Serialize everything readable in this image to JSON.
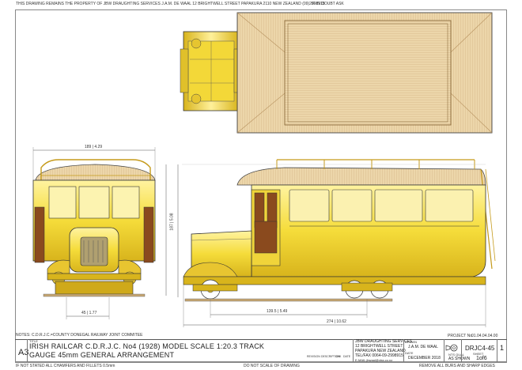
{
  "header": {
    "ownership_note": "THIS DRAWING REMAINS THE PROPERTY OF JBW DRAUGHTING SERVICES J.A.M. DE WAAL 12 BRIGHTWELL STREET PAPAKURA 2110 NEW ZEALAND (09)2998915",
    "doubt_note": "IF IN DOUBT ASK"
  },
  "dimensions": {
    "front_width": "189 | 4.29",
    "front_height": "187 | 5.08",
    "front_gauge": "45 | 1.77",
    "side_wheelbase": "139.5 | 5.49",
    "side_length": "274 | 10.62"
  },
  "title_block": {
    "notes": "NOTES: C.D.R.J.C.=COUNTY DONEGAL RAILWAY JOINT COMMITEE",
    "sheet_size": "A3",
    "title_label": "TITLE",
    "title_line1": "IRISH RAILCAR C.D.R.J.C. No4 (1928) MODEL SCALE 1:20.3 TRACK",
    "title_line2": "GAUGE 45mm  GENERAL ARRANGEMENT",
    "company_line1": "JBW DRAUGHTING SERVICES",
    "company_line2": "12 BRIGHTWELL STREET",
    "company_line3": "PAPAKURA NEW ZEALAND",
    "company_line4": "TEL/FAX 0064-09-2998915",
    "company_line5": "E-MAIL:jbwaal@xtra.co.nz",
    "drawn_label": "DRAWN",
    "drawn_by": "J.A.M. DE WAAL",
    "date_label": "DATE",
    "date": "DECEMBER 2018",
    "project_label": "PROJECT No.",
    "project_no": "01.04.04.04.00",
    "ntsqual_label": "NTS QUAL",
    "scale_value": "AS SHOWN",
    "drg_no": "DRJC4-45",
    "revision": "1",
    "sheet_label": "SHEET",
    "sheet": "1of6",
    "revision_col": "REVISION",
    "description_col": "DESCRIPTION",
    "chk_label": "CHK",
    "date_col": "DATE",
    "footer_left": "IF NOT STATED ALL CHAMFERS AND FILLETS 0.5mm",
    "footer_mid": "DO NOT SCALE OF DRAWING",
    "footer_right": "REMOVE ALL BURS AND SHARP EDGES"
  },
  "colors": {
    "body_yellow": "#f5dc3a",
    "body_shade": "#d9b820",
    "roof_wood": "#e8cfa0",
    "roof_line": "#c9a873",
    "panel_brown": "#8a4a1e",
    "line": "#333333"
  }
}
